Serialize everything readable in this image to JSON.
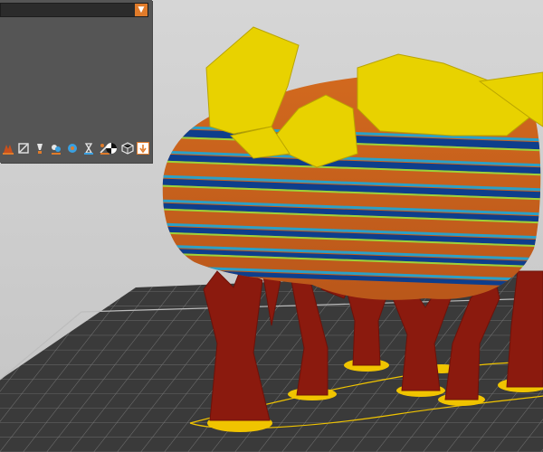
{
  "viewport": {
    "background": "#cfcfcf",
    "bed_color": "#3a3a3a",
    "grid_color": "#8a8a8a",
    "support_color": "#8b1a0e",
    "support_base_color": "#f0c400",
    "object_colors": [
      "#e8d200",
      "#d2691e",
      "#0e3e8c",
      "#2aa0c8",
      "#9cd23a"
    ]
  },
  "legend_panel": {
    "view_type_select": {
      "value": ""
    },
    "toolbar": {
      "icons": [
        "feature-type-icon",
        "height-icon",
        "width-icon",
        "speed-icon",
        "fan-speed-icon",
        "temperature-icon",
        "volumetric-flow-icon",
        "tool-icon",
        "color-print-icon",
        "shells-icon",
        "legend-toggle-icon"
      ]
    },
    "panel_color": "#555555",
    "accent_color": "#e07b2a"
  }
}
